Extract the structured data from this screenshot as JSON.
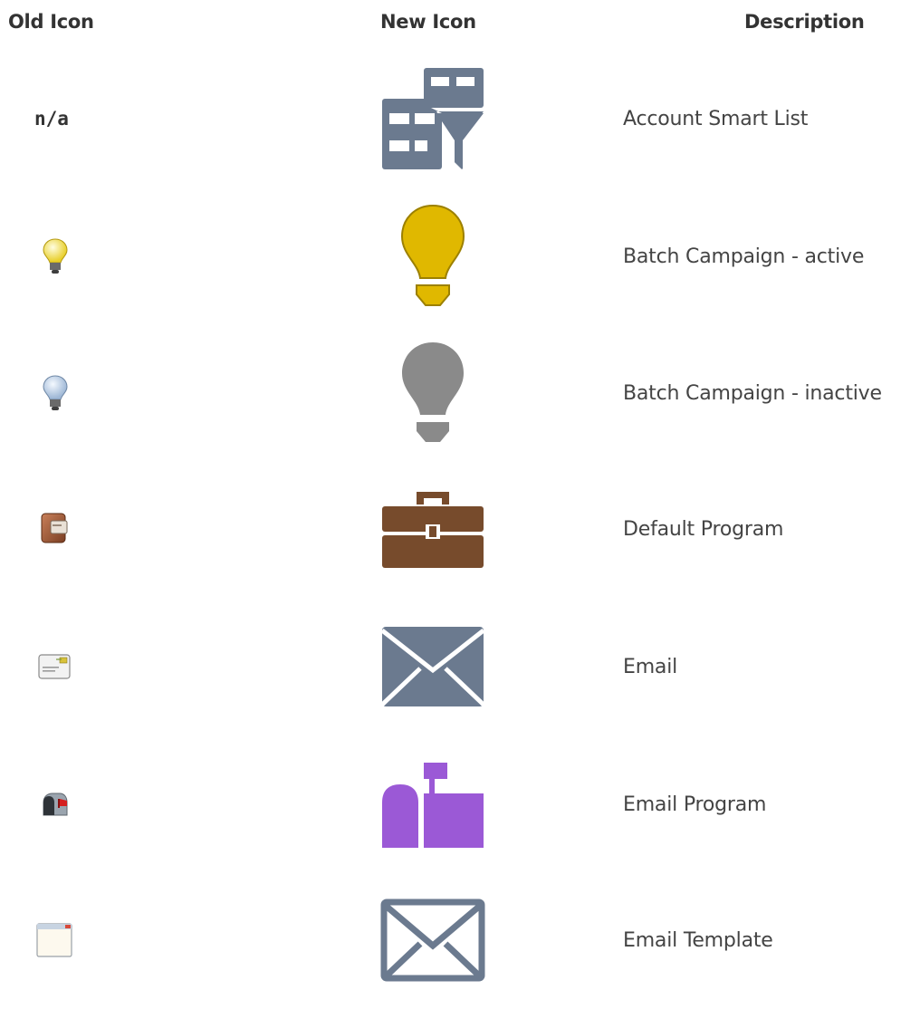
{
  "headers": {
    "old_icon": "Old Icon",
    "new_icon": "New Icon",
    "description": "Description"
  },
  "rows": [
    {
      "old_icon": "",
      "old_text": "n/a",
      "new_icon": "account-smart-list-icon",
      "new_color": "#6B7A8F",
      "description": "Account Smart List"
    },
    {
      "old_icon": "yellow-lightbulb-icon",
      "new_icon": "lightbulb-icon",
      "new_color": "#E0B800",
      "description": "Batch Campaign - active"
    },
    {
      "old_icon": "blue-lightbulb-icon",
      "new_icon": "lightbulb-icon",
      "new_color": "#8A8A8A",
      "description": "Batch Campaign - inactive"
    },
    {
      "old_icon": "brown-folder-icon",
      "new_icon": "briefcase-icon",
      "new_color": "#774B2C",
      "description": "Default Program"
    },
    {
      "old_icon": "envelope-card-icon",
      "new_icon": "envelope-icon",
      "new_color": "#6B7A8F",
      "description": "Email"
    },
    {
      "old_icon": "mailbox-icon",
      "new_icon": "mailbox-icon",
      "new_color": "#9B59D6",
      "description": "Email Program"
    },
    {
      "old_icon": "window-icon",
      "new_icon": "envelope-outline-icon",
      "new_color": "#6B7A8F",
      "description": "Email Template"
    }
  ]
}
